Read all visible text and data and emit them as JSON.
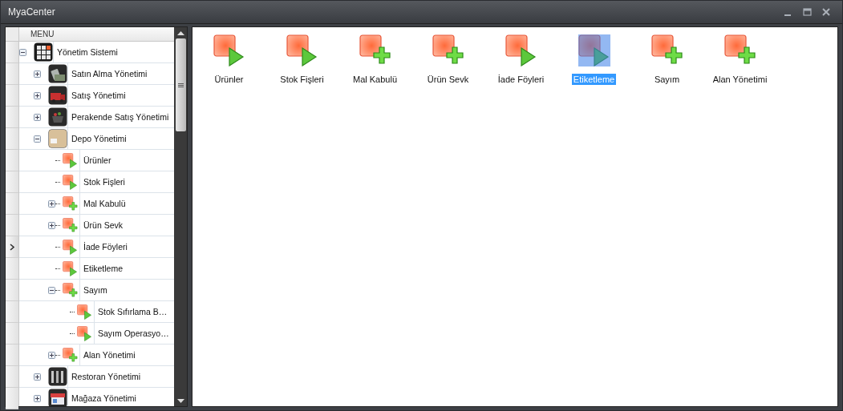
{
  "window": {
    "title": "MyaCenter"
  },
  "menu": {
    "header": "MENU",
    "tree": [
      {
        "label": "Yönetim Sistemi",
        "kind": "system",
        "expanded": true,
        "focused": false,
        "children": [
          {
            "label": "Satın Alma Yönetimi",
            "kind": "module",
            "expanded": false,
            "focused": false
          },
          {
            "label": "Satış Yönetimi",
            "kind": "module",
            "expanded": false,
            "focused": false
          },
          {
            "label": "Perakende Satış Yönetimi",
            "kind": "module",
            "expanded": false,
            "focused": false
          },
          {
            "label": "Depo Yönetimi",
            "kind": "module",
            "expanded": true,
            "focused": false,
            "children": [
              {
                "label": "Ürünler",
                "kind": "play",
                "focused": false
              },
              {
                "label": "Stok Fişleri",
                "kind": "play",
                "focused": false
              },
              {
                "label": "Mal Kabulü",
                "kind": "add",
                "expanded": false,
                "focused": false
              },
              {
                "label": "Ürün Sevk",
                "kind": "add",
                "expanded": false,
                "focused": false
              },
              {
                "label": "İade Föyleri",
                "kind": "play",
                "focused": true
              },
              {
                "label": "Etiketleme",
                "kind": "play",
                "focused": false
              },
              {
                "label": "Sayım",
                "kind": "add",
                "expanded": true,
                "focused": false,
                "children": [
                  {
                    "label": "Stok Sıfırlama B…",
                    "kind": "play",
                    "focused": false
                  },
                  {
                    "label": "Sayım Operasyo…",
                    "kind": "play",
                    "focused": false
                  }
                ]
              },
              {
                "label": "Alan Yönetimi",
                "kind": "add",
                "expanded": false,
                "focused": false
              }
            ]
          },
          {
            "label": "Restoran Yönetimi",
            "kind": "module",
            "expanded": false,
            "focused": false
          },
          {
            "label": "Mağaza Yönetimi",
            "kind": "module",
            "expanded": false,
            "focused": false
          }
        ]
      }
    ]
  },
  "content": {
    "items": [
      {
        "label": "Ürünler",
        "kind": "play",
        "selected": false
      },
      {
        "label": "Stok Fişleri",
        "kind": "play",
        "selected": false
      },
      {
        "label": "Mal Kabulü",
        "kind": "add",
        "selected": false
      },
      {
        "label": "Ürün Sevk",
        "kind": "add",
        "selected": false
      },
      {
        "label": "İade Föyleri",
        "kind": "play",
        "selected": false
      },
      {
        "label": "Etiketleme",
        "kind": "play",
        "selected": true
      },
      {
        "label": "Sayım",
        "kind": "add",
        "selected": false
      },
      {
        "label": "Alan Yönetimi",
        "kind": "add",
        "selected": false
      }
    ]
  }
}
